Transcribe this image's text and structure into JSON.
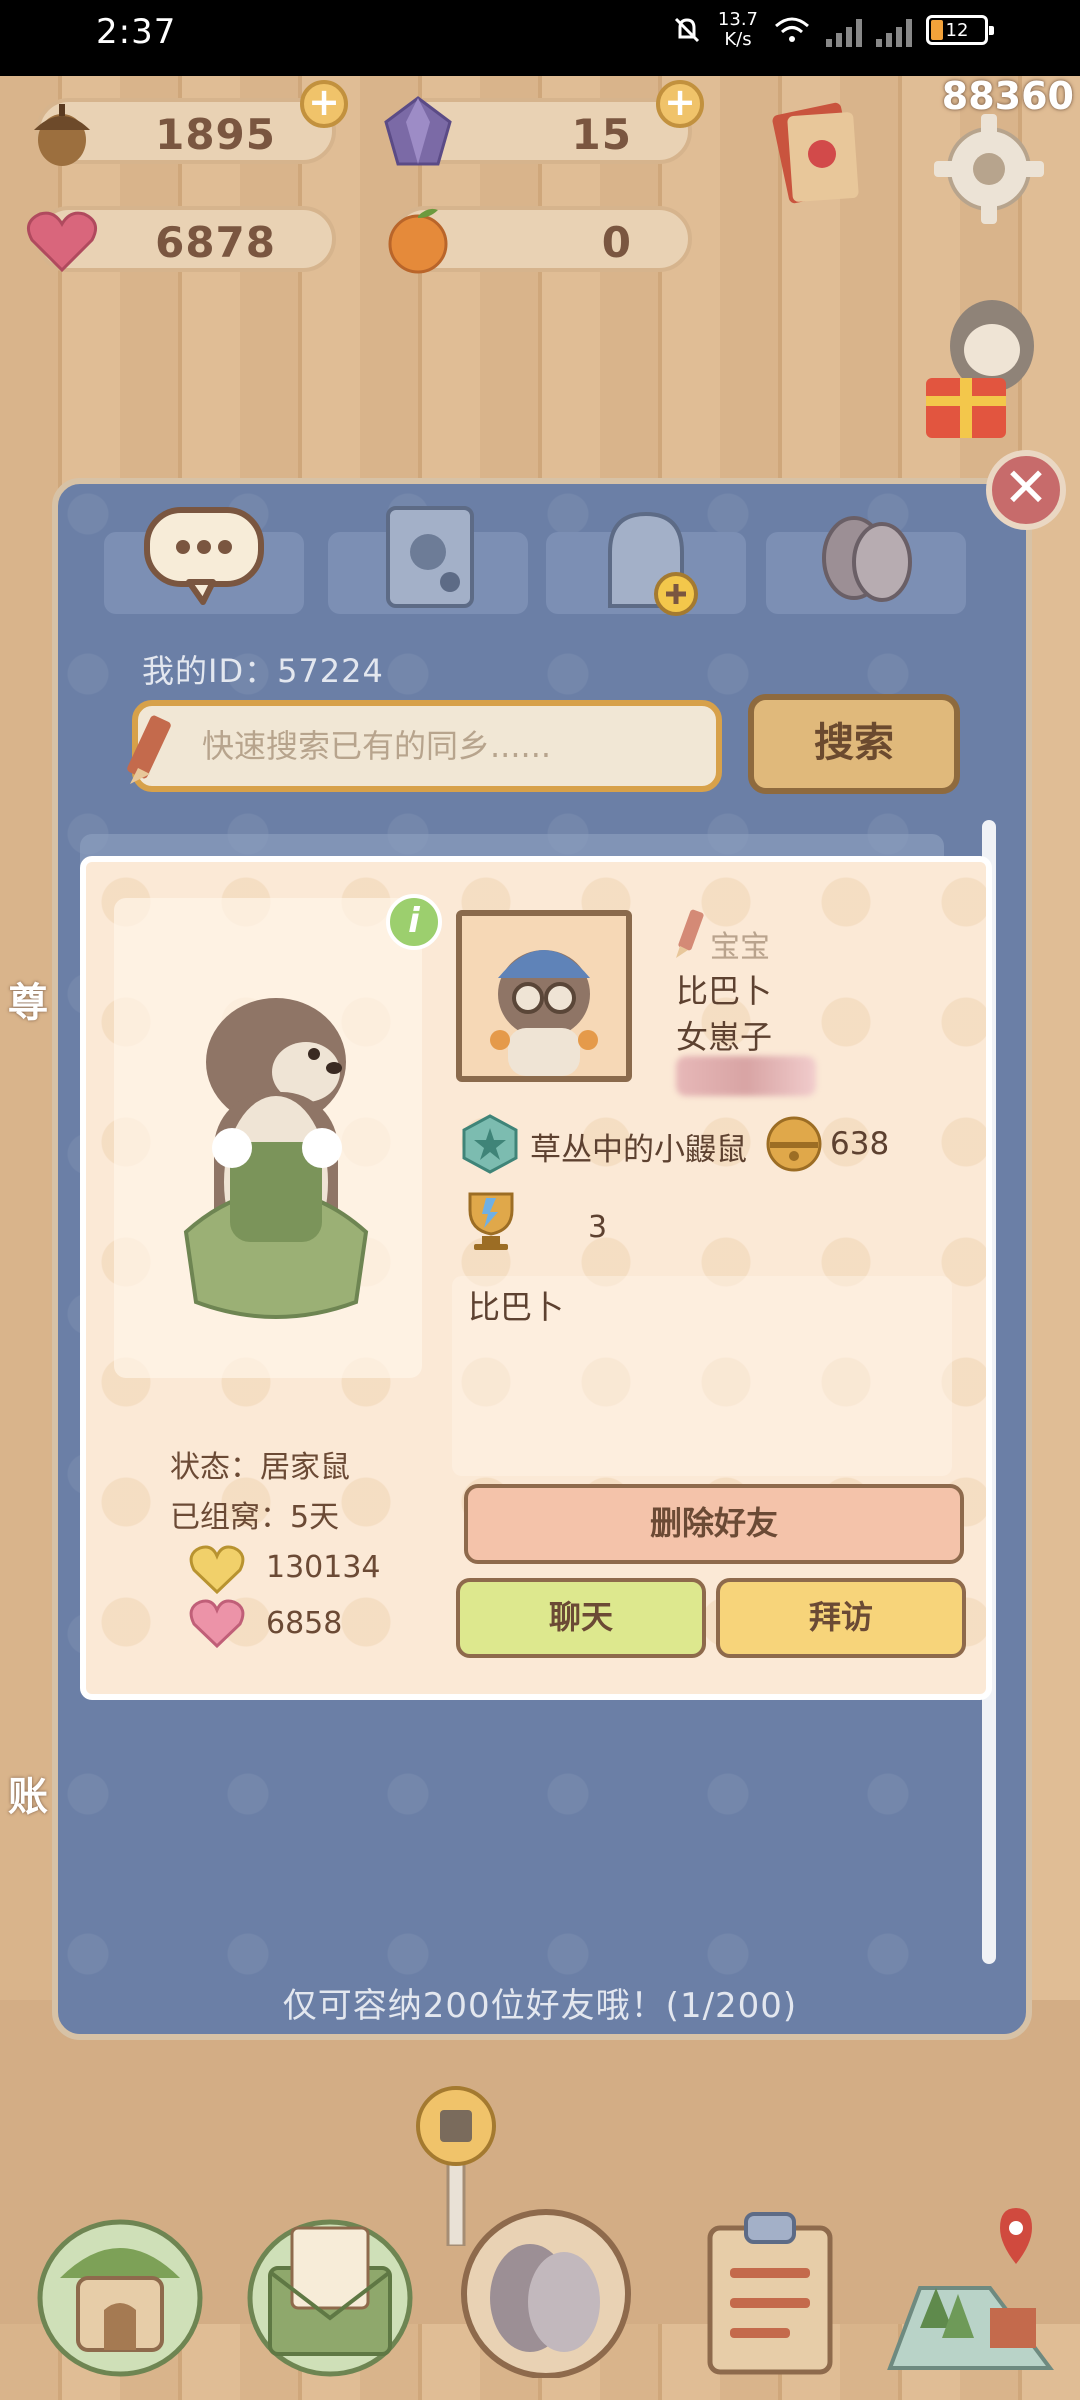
{
  "status_bar": {
    "time": "2:37",
    "net_speed": "13.7",
    "net_unit": "K/s",
    "battery": "12"
  },
  "resources": {
    "acorns": "1895",
    "crystals": "15",
    "hearts": "6878",
    "oranges": "0"
  },
  "score": "88360",
  "side_labels": {
    "left_top": "尊",
    "left_bottom": "账"
  },
  "friends_dialog": {
    "tabs": [
      {
        "name": "chat",
        "icon": "speech-bubble-icon"
      },
      {
        "name": "friend-book",
        "icon": "notebook-icon"
      },
      {
        "name": "add-friend",
        "icon": "add-person-icon"
      },
      {
        "name": "paws",
        "icon": "paws-icon"
      }
    ],
    "my_id": "我的ID：57224",
    "search": {
      "placeholder": "快速搜索已有的同乡......",
      "button": "搜索"
    },
    "friend_card": {
      "remark": "宝宝",
      "nickname": "比巴卜",
      "gender": "女崽子",
      "rank_title": "草丛中的小鼹鼠",
      "bells": "638",
      "trophies": "3",
      "signature": "比巴卜",
      "status": "状态：居家鼠",
      "nest_days": "已组窝：5天",
      "gold_hearts": "130134",
      "pink_hearts": "6858",
      "delete_button": "删除好友",
      "chat_button": "聊天",
      "visit_button": "拜访"
    },
    "capacity_note": "仅可容纳200位好友哦！(1/200)"
  },
  "colors": {
    "dialog_bg": "#6b7fa6",
    "card_bg": "#fbe9d6",
    "delete_btn": "#f4c3aa",
    "chat_btn": "#dde88e",
    "visit_btn": "#f7d47a",
    "search_btn": "#e0b97b"
  },
  "bottom_nav": [
    {
      "icon": "home-icon"
    },
    {
      "icon": "mail-icon"
    },
    {
      "icon": "friends-icon"
    },
    {
      "icon": "clipboard-icon"
    },
    {
      "icon": "map-icon"
    }
  ]
}
